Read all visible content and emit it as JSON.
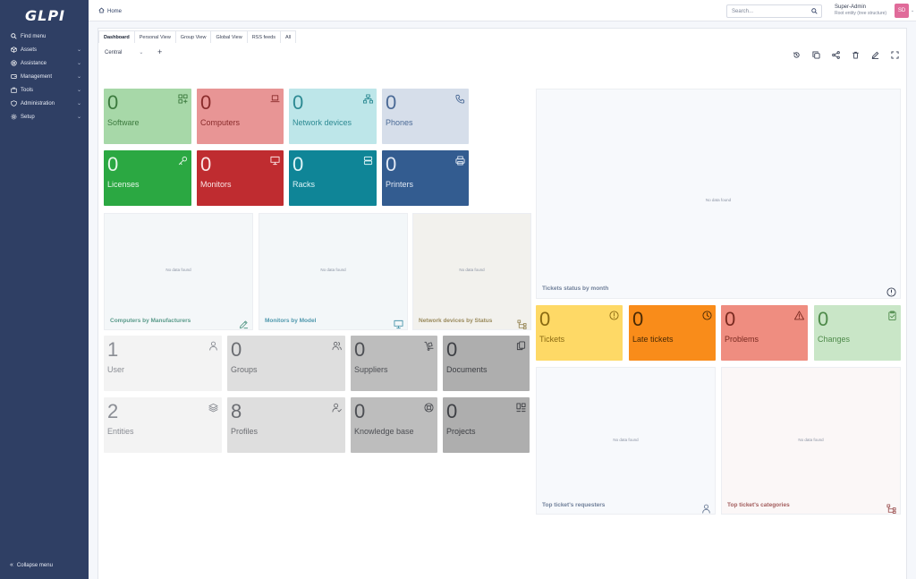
{
  "app": {
    "logo": "GLPI"
  },
  "sidebar": {
    "items": [
      {
        "label": "Find menu",
        "icon": "search-icon",
        "chevron": false
      },
      {
        "label": "Assets",
        "icon": "cube-icon",
        "chevron": true
      },
      {
        "label": "Assistance",
        "icon": "lifebuoy-icon",
        "chevron": true
      },
      {
        "label": "Management",
        "icon": "wallet-icon",
        "chevron": true
      },
      {
        "label": "Tools",
        "icon": "briefcase-icon",
        "chevron": true
      },
      {
        "label": "Administration",
        "icon": "shield-icon",
        "chevron": true
      },
      {
        "label": "Setup",
        "icon": "gear-icon",
        "chevron": true
      }
    ],
    "collapse_label": "Collapse menu"
  },
  "topbar": {
    "breadcrumb": "Home",
    "search_placeholder": "Search...",
    "user_name": "Super-Admin",
    "entity": "Root entity (tree structure)",
    "avatar_initials": "SD"
  },
  "tabs": [
    "Dashboard",
    "Personal View",
    "Group View",
    "Global View",
    "RSS feeds",
    "All"
  ],
  "dashboard_selector": "Central",
  "counters_assets": [
    {
      "value": "0",
      "label": "Software",
      "icon": "apps-icon",
      "bg": "#a7d8a8",
      "fg": "#3c7a3e"
    },
    {
      "value": "0",
      "label": "Computers",
      "icon": "laptop-icon",
      "bg": "#e89595",
      "fg": "#8a2c2c"
    },
    {
      "value": "0",
      "label": "Network devices",
      "icon": "network-icon",
      "bg": "#bde6e9",
      "fg": "#2d8a93"
    },
    {
      "value": "0",
      "label": "Phones",
      "icon": "phone-icon",
      "bg": "#d6deea",
      "fg": "#4b6a96"
    },
    {
      "value": "0",
      "label": "Licenses",
      "icon": "key-icon",
      "bg": "#2ba842",
      "fg": "#e6f7e9"
    },
    {
      "value": "0",
      "label": "Monitors",
      "icon": "monitor-icon",
      "bg": "#bf2c30",
      "fg": "#fbe5e5"
    },
    {
      "value": "0",
      "label": "Racks",
      "icon": "server-icon",
      "bg": "#0f8597",
      "fg": "#dff5f8"
    },
    {
      "value": "0",
      "label": "Printers",
      "icon": "printer-icon",
      "bg": "#335c90",
      "fg": "#e2e9f4"
    }
  ],
  "chart_panels": [
    {
      "title": "Computers by Manufacturers",
      "empty": "No data found",
      "icon": "edit-icon",
      "bg": "#f4f7f9",
      "fg": "#5a9b8b"
    },
    {
      "title": "Monitors by Model",
      "empty": "No data found",
      "icon": "monitor-icon",
      "bg": "#f3f7f9",
      "fg": "#4f98ad"
    },
    {
      "title": "Network devices by Status",
      "empty": "No data found",
      "icon": "hierarchy-icon",
      "bg": "#f2f1ed",
      "fg": "#9a8a5c"
    }
  ],
  "counters_admin": [
    {
      "value": "1",
      "label": "User",
      "icon": "user-icon",
      "bg": "#f3f3f3",
      "fg": "#8a8d94"
    },
    {
      "value": "0",
      "label": "Groups",
      "icon": "users-icon",
      "bg": "#dedede",
      "fg": "#6b6d72"
    },
    {
      "value": "0",
      "label": "Suppliers",
      "icon": "dolly-icon",
      "bg": "#bdbdbd",
      "fg": "#4d4f54"
    },
    {
      "value": "0",
      "label": "Documents",
      "icon": "files-icon",
      "bg": "#aeaeae",
      "fg": "#3e4045"
    },
    {
      "value": "2",
      "label": "Entities",
      "icon": "layers-icon",
      "bg": "#f3f3f3",
      "fg": "#8a8d94"
    },
    {
      "value": "8",
      "label": "Profiles",
      "icon": "user-check-icon",
      "bg": "#dedede",
      "fg": "#6b6d72"
    },
    {
      "value": "0",
      "label": "Knowledge base",
      "icon": "lifebuoy-icon",
      "bg": "#bdbdbd",
      "fg": "#4d4f54"
    },
    {
      "value": "0",
      "label": "Projects",
      "icon": "kanban-icon",
      "bg": "#aeaeae",
      "fg": "#3e4045"
    }
  ],
  "tickets_panel": {
    "title": "Tickets status by month",
    "empty": "No data found",
    "icon": "alert-circle-icon"
  },
  "counters_tickets": [
    {
      "value": "0",
      "label": "Tickets",
      "icon": "alert-circle-icon",
      "bg": "#fed966",
      "fg": "#8a6a12"
    },
    {
      "value": "0",
      "label": "Late tickets",
      "icon": "clock-icon",
      "bg": "#f98c1a",
      "fg": "#4a2a05"
    },
    {
      "value": "0",
      "label": "Problems",
      "icon": "warning-icon",
      "bg": "#ef8d80",
      "fg": "#7a2a20"
    },
    {
      "value": "0",
      "label": "Changes",
      "icon": "clipboard-check-icon",
      "bg": "#c9e6c7",
      "fg": "#4e8a4a"
    }
  ],
  "bottom_panels": [
    {
      "title": "Top ticket's requesters",
      "empty": "No data found",
      "icon": "user-icon",
      "bg": "#f7f9fc",
      "fg": "#6f7f99"
    },
    {
      "title": "Top ticket's categories",
      "empty": "No data found",
      "icon": "hierarchy-icon",
      "bg": "#fbf7f7",
      "fg": "#a25c5c"
    }
  ]
}
